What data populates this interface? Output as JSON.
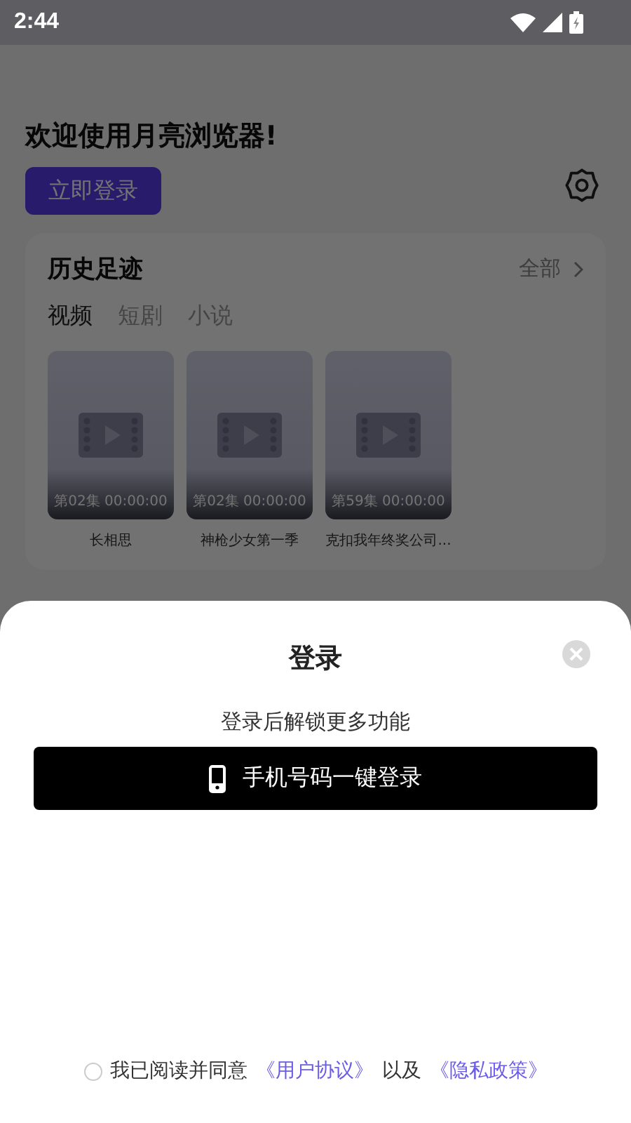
{
  "status_bar": {
    "time": "2:44"
  },
  "header": {
    "welcome": "欢迎使用月亮浏览器!",
    "login_button": "立即登录"
  },
  "history": {
    "title": "历史足迹",
    "more": "全部",
    "tabs": [
      {
        "label": "视频",
        "selected": true
      },
      {
        "label": "短剧",
        "selected": false
      },
      {
        "label": "小说",
        "selected": false
      }
    ],
    "items": [
      {
        "episode": "第02集 00:00:00",
        "title": "长相思"
      },
      {
        "episode": "第02集 00:00:00",
        "title": "神枪少女第一季"
      },
      {
        "episode": "第59集 00:00:00",
        "title": "克扣我年终奖公司..."
      }
    ]
  },
  "login_sheet": {
    "title": "登录",
    "subtitle": "登录后解锁更多功能",
    "phone_button": "手机号码一键登录",
    "agreement": {
      "checked": false,
      "text": "我已阅读并同意",
      "user_link": "《用户协议》",
      "joiner": "以及",
      "privacy_link": "《隐私政策》"
    }
  }
}
